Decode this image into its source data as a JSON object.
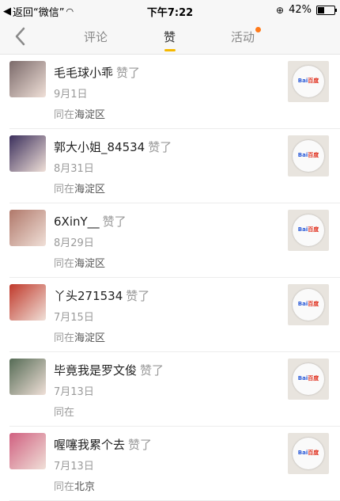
{
  "status_bar": {
    "back_label": "返回“微信”",
    "time": "下午7:22",
    "battery_text": "42%",
    "battery_level": 0.42
  },
  "nav": {
    "tabs": [
      {
        "label": "评论",
        "active": false
      },
      {
        "label": "赞",
        "active": true
      },
      {
        "label": "活动",
        "active": false,
        "has_badge": true
      }
    ],
    "accent_color": "#f5b800",
    "badge_color": "#ff7a1a"
  },
  "liked_text": "赞了",
  "location_prefix": "同在",
  "items": [
    {
      "name": "毛毛球小乖",
      "date": "9月1日",
      "place": "海淀区",
      "avatar_color": "#7b6a6a"
    },
    {
      "name": "郭大小姐_84534",
      "date": "8月31日",
      "place": "海淀区",
      "avatar_color": "#3b2f5c"
    },
    {
      "name": "6XinY__",
      "date": "8月29日",
      "place": "海淀区",
      "avatar_color": "#b0786a"
    },
    {
      "name": "丫头271534",
      "date": "7月15日",
      "place": "海淀区",
      "avatar_color": "#c0392b"
    },
    {
      "name": "毕竟我是罗文俊",
      "date": "7月13日",
      "place": "",
      "avatar_color": "#556b55"
    },
    {
      "name": "喔噻我累个去",
      "date": "7月13日",
      "place": "北京",
      "avatar_color": "#d06080"
    }
  ],
  "thumbnail_logo": {
    "left": "Bai",
    "right": "百度"
  }
}
